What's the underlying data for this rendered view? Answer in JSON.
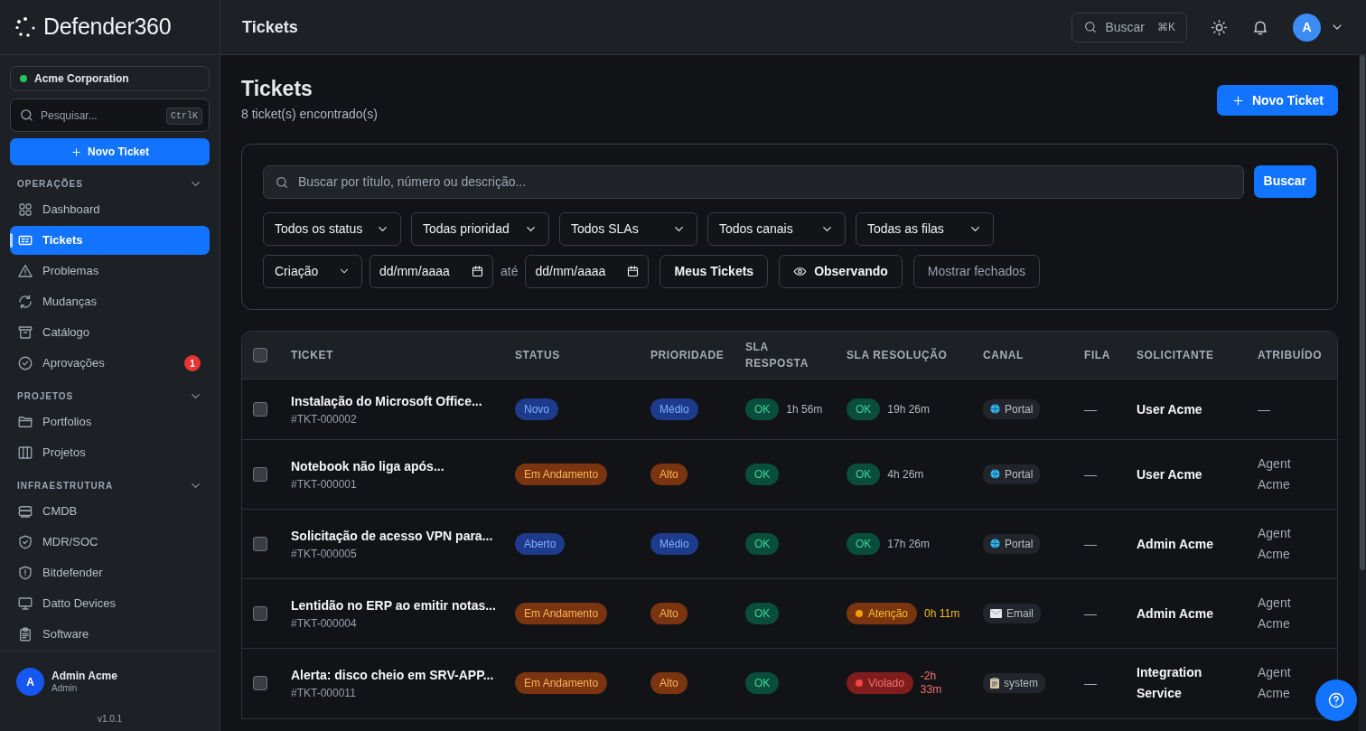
{
  "sidebar": {
    "logo": "Defender360",
    "org": "Acme Corporation",
    "search": {
      "placeholder": "Pesquisar...",
      "shortcut": "CtrlK"
    },
    "new_button": "Novo Ticket",
    "sections": [
      {
        "title": "OPERAÇÕES",
        "expanded": true,
        "items": [
          {
            "label": "Dashboard",
            "kind": "grid",
            "selected": false
          },
          {
            "label": "Tickets",
            "kind": "ticket",
            "selected": true
          },
          {
            "label": "Problemas",
            "kind": "warning",
            "selected": false
          },
          {
            "label": "Mudanças",
            "kind": "refresh",
            "selected": false
          },
          {
            "label": "Catálogo",
            "kind": "archive",
            "selected": false
          },
          {
            "label": "Aprovações",
            "kind": "check",
            "selected": false,
            "badge": "1"
          }
        ]
      },
      {
        "title": "PROJETOS",
        "expanded": true,
        "items": [
          {
            "label": "Portfolios",
            "kind": "folder",
            "selected": false
          },
          {
            "label": "Projetos",
            "kind": "columns",
            "selected": false
          }
        ]
      },
      {
        "title": "INFRAESTRUTURA",
        "expanded": true,
        "items": [
          {
            "label": "CMDB",
            "kind": "database",
            "selected": false
          },
          {
            "label": "MDR/SOC",
            "kind": "shieldcheck",
            "selected": false
          },
          {
            "label": "Bitdefender",
            "kind": "shieldalert",
            "selected": false
          },
          {
            "label": "Datto Devices",
            "kind": "monitor",
            "selected": false
          },
          {
            "label": "Software",
            "kind": "clipboard",
            "selected": false
          }
        ]
      }
    ],
    "user": {
      "initial": "A",
      "name": "Admin Acme",
      "role": "Admin"
    },
    "version": "v1.0.1"
  },
  "header": {
    "title": "Tickets",
    "search": {
      "label": "Buscar",
      "shortcut": "⌘K"
    },
    "avatar": "A"
  },
  "page": {
    "title": "Tickets",
    "subtitle": "8 ticket(s) encontrado(s)",
    "new_button": "Novo Ticket"
  },
  "filters": {
    "search": {
      "placeholder": "Buscar por título, número ou descrição..."
    },
    "search_button": "Buscar",
    "dropdowns": [
      "Todos os status",
      "Todas prioridad",
      "Todos SLAs",
      "Todos canais",
      "Todas as filas"
    ],
    "date_type": "Criação",
    "date_from": {
      "placeholder": "dd/mm/aaaa"
    },
    "date_sep": "até",
    "date_to": {
      "placeholder": "dd/mm/aaaa"
    },
    "toggles": [
      {
        "label": "Meus Tickets",
        "kind": "plain",
        "active": true
      },
      {
        "label": "Observando",
        "kind": "eye",
        "active": true
      },
      {
        "label": "Mostrar fechados",
        "kind": "plain",
        "active": false
      }
    ]
  },
  "table": {
    "all_selected": false,
    "columns": [
      "TICKET",
      "STATUS",
      "PRIORIDADE",
      "SLA RESPOSTA",
      "SLA RESOLUÇÃO",
      "CANAL",
      "FILA",
      "SOLICITANTE",
      "ATRIBUÍDO"
    ],
    "rows": [
      {
        "selected": false,
        "title": "Instalação do Microsoft Office...",
        "number": "#TKT-000002",
        "status": {
          "label": "Novo",
          "kind": "blue"
        },
        "priority": {
          "label": "Médio",
          "kind": "blue"
        },
        "sla_response": {
          "label": "OK",
          "kind": "ok",
          "time": "1h 56m"
        },
        "sla_resolution": {
          "label": "OK",
          "kind": "ok",
          "time": "19h 26m"
        },
        "channel": {
          "label": "Portal",
          "kind": "portal"
        },
        "queue": "—",
        "requester": "User Acme",
        "assignee": "—"
      },
      {
        "selected": false,
        "title": "Notebook não liga após...",
        "number": "#TKT-000001",
        "status": {
          "label": "Em Andamento",
          "kind": "orange"
        },
        "priority": {
          "label": "Alto",
          "kind": "orange"
        },
        "sla_response": {
          "label": "OK",
          "kind": "ok"
        },
        "sla_resolution": {
          "label": "OK",
          "kind": "ok",
          "time": "4h 26m"
        },
        "channel": {
          "label": "Portal",
          "kind": "portal"
        },
        "queue": "—",
        "requester": "User Acme",
        "assignee": "Agent Acme"
      },
      {
        "selected": false,
        "title": "Solicitação de acesso VPN para...",
        "number": "#TKT-000005",
        "status": {
          "label": "Aberto",
          "kind": "blue"
        },
        "priority": {
          "label": "Médio",
          "kind": "blue"
        },
        "sla_response": {
          "label": "OK",
          "kind": "ok"
        },
        "sla_resolution": {
          "label": "OK",
          "kind": "ok",
          "time": "17h 26m"
        },
        "channel": {
          "label": "Portal",
          "kind": "portal"
        },
        "queue": "—",
        "requester": "Admin Acme",
        "assignee": "Agent Acme"
      },
      {
        "selected": false,
        "title": "Lentidão no ERP ao emitir notas...",
        "number": "#TKT-000004",
        "status": {
          "label": "Em Andamento",
          "kind": "orange"
        },
        "priority": {
          "label": "Alto",
          "kind": "orange"
        },
        "sla_response": {
          "label": "OK",
          "kind": "ok"
        },
        "sla_resolution": {
          "label": "Atenção",
          "kind": "warning",
          "time": "0h 11m"
        },
        "channel": {
          "label": "Email",
          "kind": "email"
        },
        "queue": "—",
        "requester": "Admin Acme",
        "assignee": "Agent Acme"
      },
      {
        "selected": false,
        "title": "Alerta: disco cheio em SRV-APP...",
        "number": "#TKT-000011",
        "status": {
          "label": "Em Andamento",
          "kind": "orange"
        },
        "priority": {
          "label": "Alto",
          "kind": "orange"
        },
        "sla_response": {
          "label": "OK",
          "kind": "ok"
        },
        "sla_resolution": {
          "label": "Violado",
          "kind": "violated",
          "time": "-2h 33m"
        },
        "channel": {
          "label": "system",
          "kind": "system"
        },
        "queue": "—",
        "requester": "Integration Service",
        "assignee": "Agent Acme"
      }
    ]
  }
}
